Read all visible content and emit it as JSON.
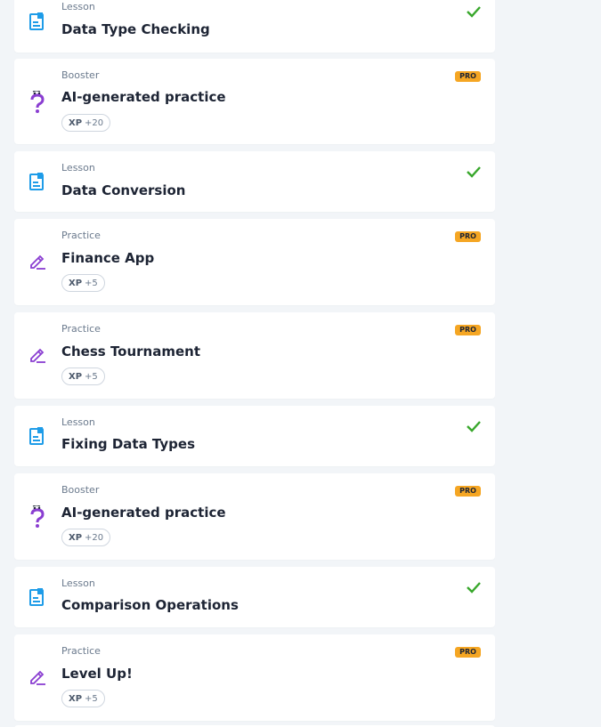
{
  "items": [
    {
      "kind": "Lesson",
      "title": "Data Type Checking",
      "icon": "lesson-doc-icon",
      "status": "completed"
    },
    {
      "kind": "Booster",
      "title": "AI-generated practice",
      "icon": "question-booster-icon",
      "pro": "PRO",
      "xp_label": "XP",
      "xp_value": "+20"
    },
    {
      "kind": "Lesson",
      "title": "Data Conversion",
      "icon": "lesson-doc-icon",
      "status": "completed"
    },
    {
      "kind": "Practice",
      "title": "Finance App",
      "icon": "pencil-icon",
      "pro": "PRO",
      "xp_label": "XP",
      "xp_value": "+5"
    },
    {
      "kind": "Practice",
      "title": "Chess Tournament",
      "icon": "pencil-icon",
      "pro": "PRO",
      "xp_label": "XP",
      "xp_value": "+5"
    },
    {
      "kind": "Lesson",
      "title": "Fixing Data Types",
      "icon": "lesson-doc-icon",
      "status": "completed"
    },
    {
      "kind": "Booster",
      "title": "AI-generated practice",
      "icon": "question-booster-icon",
      "pro": "PRO",
      "xp_label": "XP",
      "xp_value": "+20"
    },
    {
      "kind": "Lesson",
      "title": "Comparison Operations",
      "icon": "lesson-doc-icon",
      "status": "completed"
    },
    {
      "kind": "Practice",
      "title": "Level Up!",
      "icon": "pencil-icon",
      "pro": "PRO",
      "xp_label": "XP",
      "xp_value": "+5"
    }
  ],
  "colors": {
    "lesson_icon": "#1e9ce8",
    "booster_icon": "#8a3ed1",
    "practice_icon": "#8a3ed1",
    "check": "#38a72b",
    "pro_badge": "#f5a623"
  }
}
